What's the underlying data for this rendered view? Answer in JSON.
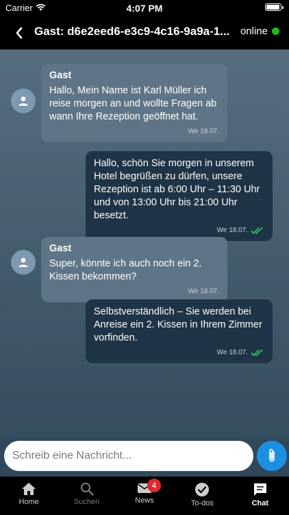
{
  "status_bar": {
    "carrier": "Carrier",
    "time": "4:07 PM",
    "battery_level": 0.95
  },
  "nav": {
    "title": "Gast: d6e2eed6-e3c9-4c16-9a9a-1...",
    "status": "online",
    "status_color": "#1fb824"
  },
  "messages": [
    {
      "direction": "incoming",
      "sender": "Gast",
      "text": "Hallo, Mein Name ist Karl Müller ich reise morgen an und wollte Fragen ab wann Ihre Rezeption geöffnet hat.",
      "time": "We 18.07."
    },
    {
      "direction": "outgoing",
      "text": "Hallo, schön Sie morgen in unserem Hotel begrüßen zu dürfen, unsere Rezeption ist ab 6:00 Uhr – 11:30 Uhr und von 13:00 Uhr bis 21:00 Uhr besetzt.",
      "time": "We 18.07.",
      "read": true
    },
    {
      "direction": "incoming",
      "sender": "Gast",
      "text": "Super, könnte ich auch noch ein 2. Kissen bekommen?",
      "time": "We 18.07."
    },
    {
      "direction": "outgoing",
      "text": "Selbstverständlich – Sie werden bei Anreise ein 2. Kissen in Ihrem Zimmer vorfinden.",
      "time": "We 18.07.",
      "read": true
    }
  ],
  "composer": {
    "placeholder": "Schreib eine Nachricht...",
    "attach_icon": "paperclip-icon"
  },
  "tabs": [
    {
      "label": "Home",
      "icon": "home-icon"
    },
    {
      "label": "Suchen",
      "icon": "search-icon"
    },
    {
      "label": "News",
      "icon": "mail-icon",
      "badge": "4"
    },
    {
      "label": "To-dos",
      "icon": "check-circle-icon"
    },
    {
      "label": "Chat",
      "icon": "chat-icon",
      "active": true
    }
  ],
  "colors": {
    "accent": "#1e8fe0",
    "badge": "#e0292f",
    "read_check": "#3bd16f"
  }
}
